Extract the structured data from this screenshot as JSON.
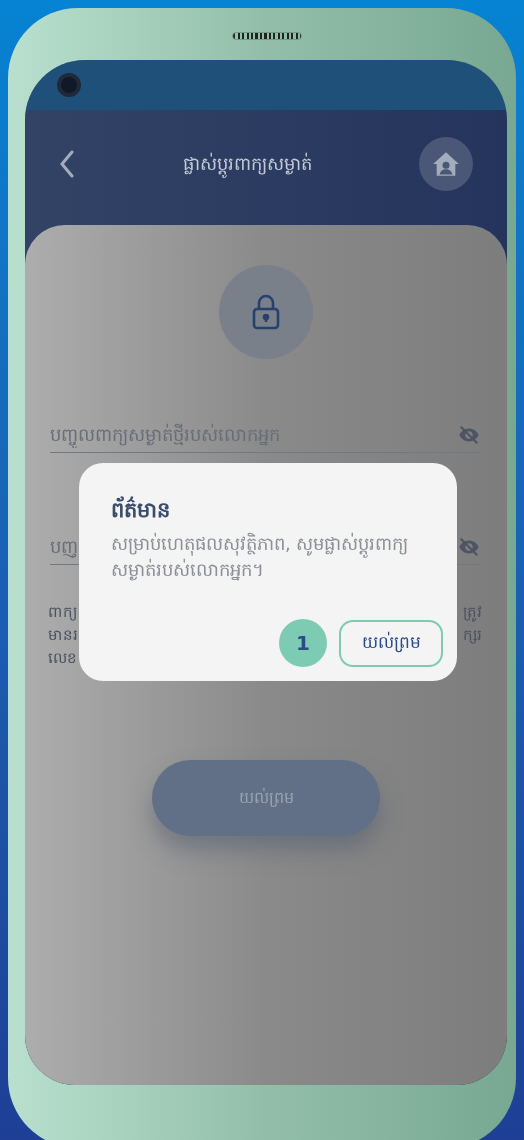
{
  "header": {
    "title": "ផ្លាស់ប្ដូរពាក្យសម្ងាត់"
  },
  "fields": [
    {
      "placeholder": "បញ្ចូលពាក្យសម្ងាត់ថ្មីរបស់លោកអ្នក"
    },
    {
      "placeholder": "បញ្"
    }
  ],
  "hint": {
    "left_lines": [
      "ពាក្យ",
      "មានរ",
      "លេខ"
    ],
    "right_lines": [
      "ត្រូវ",
      "ក្សរ"
    ]
  },
  "submit_button": "យល់ព្រម",
  "dialog": {
    "title": "ព័ត៌មាន",
    "message": "សម្រាប់ហេតុផលសុវត្ថិភាព, សូមផ្លាស់ប្ដូរពាក្យសម្ងាត់របស់លោកអ្នក។",
    "badge": "1",
    "button": "យល់ព្រម"
  }
}
